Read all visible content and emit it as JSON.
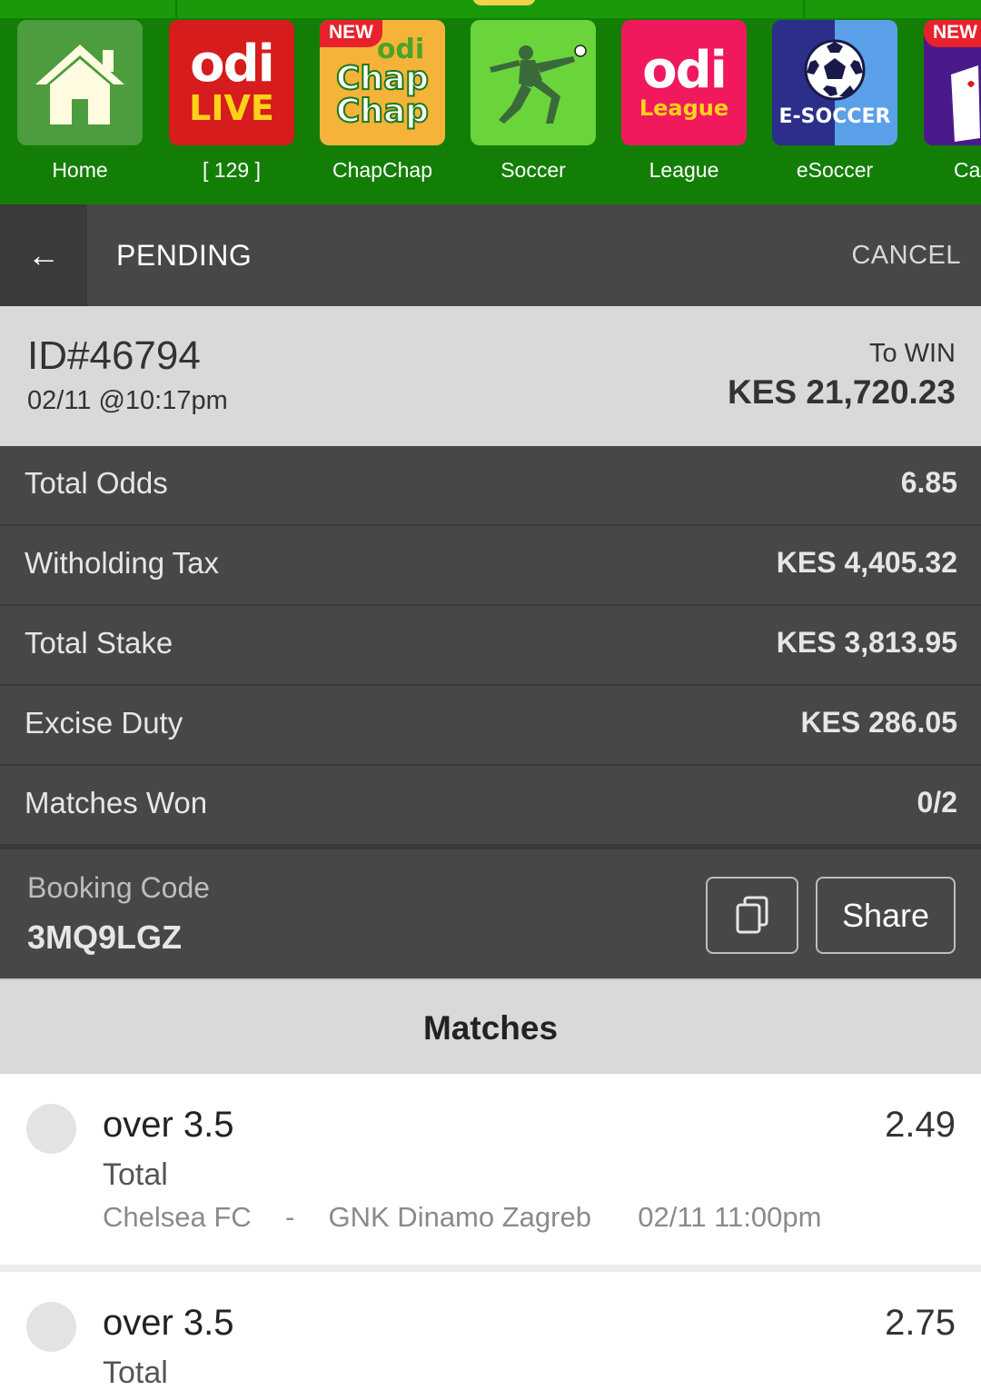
{
  "nav": {
    "items": [
      {
        "label": "Home"
      },
      {
        "label": "[ 129 ]",
        "logo_top": "odi",
        "logo_bottom": "LIVE"
      },
      {
        "label": "ChapChap",
        "badge": "NEW",
        "logo_top": "odi",
        "logo_mid": "Chap",
        "logo_bottom": "Chap"
      },
      {
        "label": "Soccer"
      },
      {
        "label": "League",
        "logo_top": "odi",
        "logo_bottom": "League"
      },
      {
        "label": "eSoccer",
        "logo_text": "E-SOCCER"
      },
      {
        "label": "Ca",
        "badge": "NEW"
      }
    ]
  },
  "header": {
    "back_icon": "←",
    "title": "PENDING",
    "cancel": "CANCEL"
  },
  "bet": {
    "id": "ID#46794",
    "date": "02/11 @10:17pm",
    "to_win_label": "To WIN",
    "to_win_amount": "KES 21,720.23"
  },
  "details": [
    {
      "label": "Total Odds",
      "value": "6.85"
    },
    {
      "label": "Witholding Tax",
      "value": "KES 4,405.32"
    },
    {
      "label": "Total Stake",
      "value": "KES 3,813.95"
    },
    {
      "label": "Excise Duty",
      "value": "KES 286.05"
    },
    {
      "label": "Matches Won",
      "value": "0/2"
    }
  ],
  "booking": {
    "label": "Booking Code",
    "code": "3MQ9LGZ",
    "share": "Share"
  },
  "matches": {
    "title": "Matches",
    "items": [
      {
        "pick": "over 3.5",
        "market": "Total",
        "home": "Chelsea FC",
        "sep": "-",
        "away": "GNK Dinamo Zagreb",
        "time": "02/11 11:00pm",
        "odds": "2.49"
      },
      {
        "pick": "over 3.5",
        "market": "Total",
        "odds": "2.75"
      }
    ]
  }
}
